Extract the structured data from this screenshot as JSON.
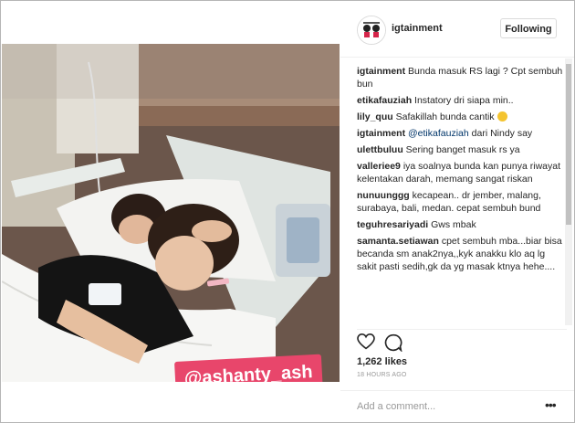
{
  "post": {
    "username": "igtainment",
    "follow_label": "Following",
    "photo_tag": "@ashanty_ash",
    "likes": "1,262 likes",
    "time": "18 HOURS AGO",
    "add_comment_placeholder": "Add a comment...",
    "more_glyph": "•••"
  },
  "comments": [
    {
      "user": "igtainment",
      "text": "Bunda masuk RS lagi ? Cpt sembuh bun"
    },
    {
      "user": "etikafauziah",
      "text": "Instatory dri siapa min.."
    },
    {
      "user": "lily_quu",
      "text": "Safakillah bunda cantik"
    },
    {
      "user": "igtainment",
      "mention": "@etikafauziah",
      "text": "dari Nindy say"
    },
    {
      "user": "ulettbuluu",
      "text": "Sering banget masuk rs ya"
    },
    {
      "user": "valleriee9",
      "text": "iya soalnya bunda kan punya riwayat kelentakan darah, memang sangat riskan"
    },
    {
      "user": "nunuunggg",
      "text": "kecapean.. dr jember, malang, surabaya, bali, medan. cepat sembuh bund"
    },
    {
      "user": "teguhresariyadi",
      "text": "Gws mbak"
    },
    {
      "user": "samanta.setiawan",
      "text": "cpet sembuh mba...biar bisa becanda sm anak2nya,,kyk anakku klo aq lg sakit pasti sedih,gk da yg masak ktnya hehe...."
    }
  ],
  "icons": {
    "like": "heart-outline-icon",
    "comment": "comment-bubble-icon",
    "more": "ellipsis-icon",
    "avatar": "account-avatar"
  },
  "colors": {
    "tag_bg": "#e8466b",
    "mention": "#003569",
    "muted": "#999999",
    "border": "#dbdbdb"
  }
}
